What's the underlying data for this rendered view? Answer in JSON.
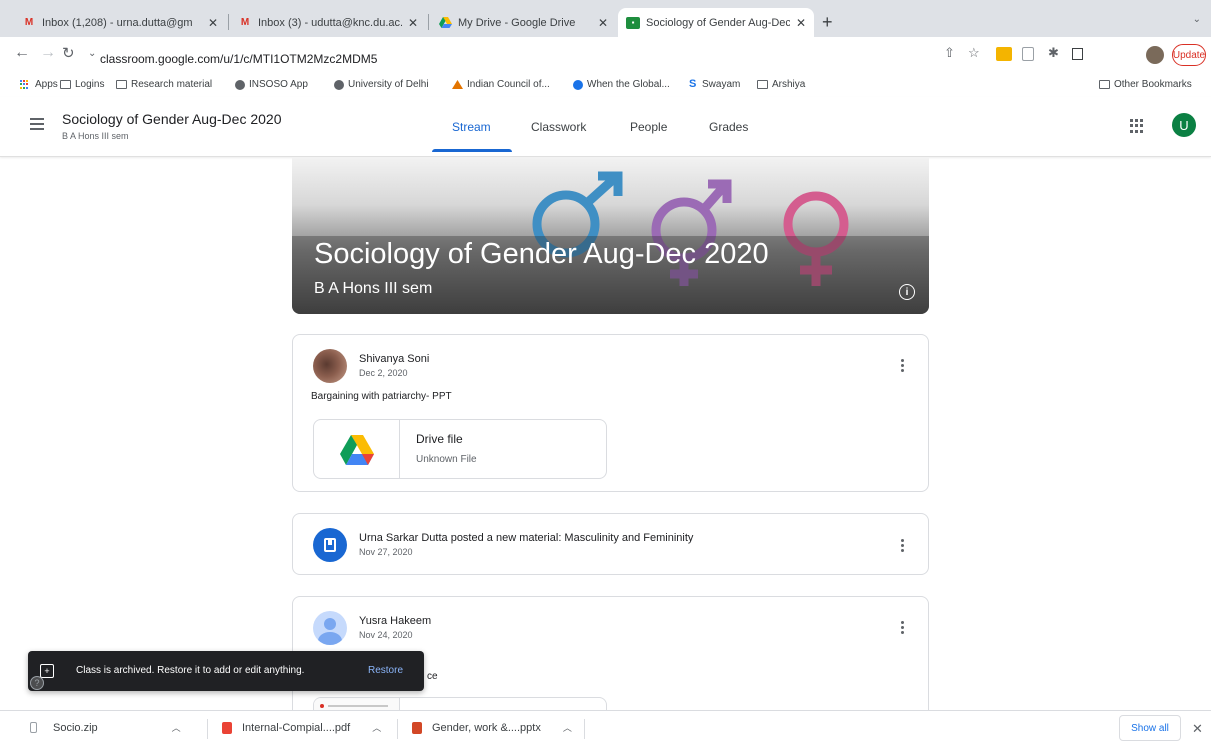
{
  "browser": {
    "tabs": [
      {
        "title": "Inbox (1,208) - urna.dutta@gm",
        "icon": "gmail-icon",
        "active": false
      },
      {
        "title": "Inbox (3) - udutta@knc.du.ac.i",
        "icon": "gmail-icon",
        "active": false
      },
      {
        "title": "My Drive - Google Drive",
        "icon": "drive-icon",
        "active": false
      },
      {
        "title": "Sociology of Gender Aug-Dec",
        "icon": "classroom-icon",
        "active": true
      }
    ],
    "new_tab_label": "+",
    "url": "classroom.google.com/u/1/c/MTI1OTM2Mzc2MDM5",
    "update_label": "Update",
    "bookmarks": [
      {
        "label": "Apps",
        "icon": "apps-icon"
      },
      {
        "label": "Logins",
        "icon": "folder-icon"
      },
      {
        "label": "Research material",
        "icon": "folder-icon"
      },
      {
        "label": "INSOSO App",
        "icon": "globe-icon"
      },
      {
        "label": "University of Delhi",
        "icon": "globe-icon"
      },
      {
        "label": "Indian Council of...",
        "icon": "icssr-icon"
      },
      {
        "label": "When the Global...",
        "icon": "site-icon"
      },
      {
        "label": "Swayam",
        "icon": "swayam-icon"
      },
      {
        "label": "Arshiya",
        "icon": "folder-icon"
      }
    ],
    "other_bookmarks": "Other Bookmarks"
  },
  "classroom": {
    "class_title": "Sociology of Gender Aug-Dec 2020",
    "class_section": "B A Hons III sem",
    "nav_tabs": [
      {
        "label": "Stream",
        "active": true
      },
      {
        "label": "Classwork",
        "active": false
      },
      {
        "label": "People",
        "active": false
      },
      {
        "label": "Grades",
        "active": false
      }
    ],
    "user_initial": "U",
    "banner": {
      "title": "Sociology of Gender Aug-Dec 2020",
      "subtitle": "B A Hons III sem",
      "info_label": "i"
    }
  },
  "stream": {
    "posts": [
      {
        "author": "Shivanya Soni",
        "date": "Dec 2, 2020",
        "text": "Bargaining with patriarchy- PPT",
        "attachment": {
          "title": "Drive file",
          "subtitle": "Unknown File"
        }
      },
      {
        "author": "Urna Sarkar Dutta posted a new material: Masculinity and Femininity",
        "date": "Nov 27, 2020"
      },
      {
        "author": "Yusra Hakeem",
        "date": "Nov 24, 2020",
        "text_fragment_1": "a",
        "text_fragment_2": "ce"
      }
    ]
  },
  "snackbar": {
    "message": "Class is archived. Restore it to add or edit anything.",
    "action": "Restore"
  },
  "downloads": {
    "items": [
      {
        "name": "Socio.zip"
      },
      {
        "name": "Internal-Compial....pdf"
      },
      {
        "name": "Gender, work &....pptx"
      }
    ],
    "show_all": "Show all"
  },
  "colors": {
    "accent": "#1967d2",
    "male_symbol": "#3f8fc4",
    "neutral_symbol": "#9b6bb5",
    "female_symbol": "#d45d8f",
    "snackbar_bg": "#202124"
  }
}
